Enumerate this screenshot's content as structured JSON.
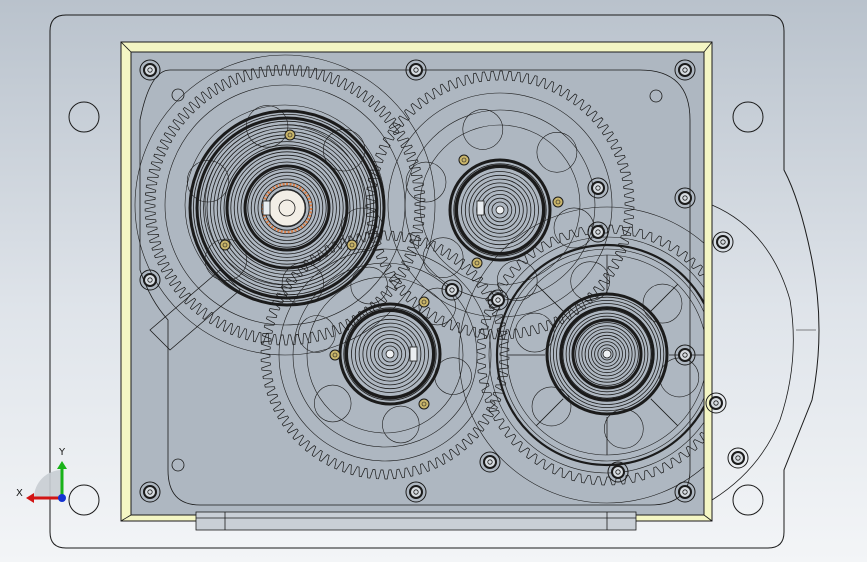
{
  "view": {
    "type": "cad-assembly-front-view",
    "background_top": "#b9c2cc",
    "background_bottom": "#f3f5f7",
    "line_color": "#1b1b1b",
    "frame_color": "#f4f6c4"
  },
  "triad": {
    "x_label": "X",
    "y_label": "Y",
    "x_color": "#d21414",
    "y_color": "#19b319",
    "z_color": "#1433d2"
  },
  "components": {
    "gears": [
      "large-gear-left",
      "gear-top-right",
      "gear-bottom-center",
      "ring-gear-right"
    ],
    "bearings": [
      "bearing-left",
      "bearing-top-right",
      "bearing-bottom-center",
      "bearing-right"
    ]
  }
}
